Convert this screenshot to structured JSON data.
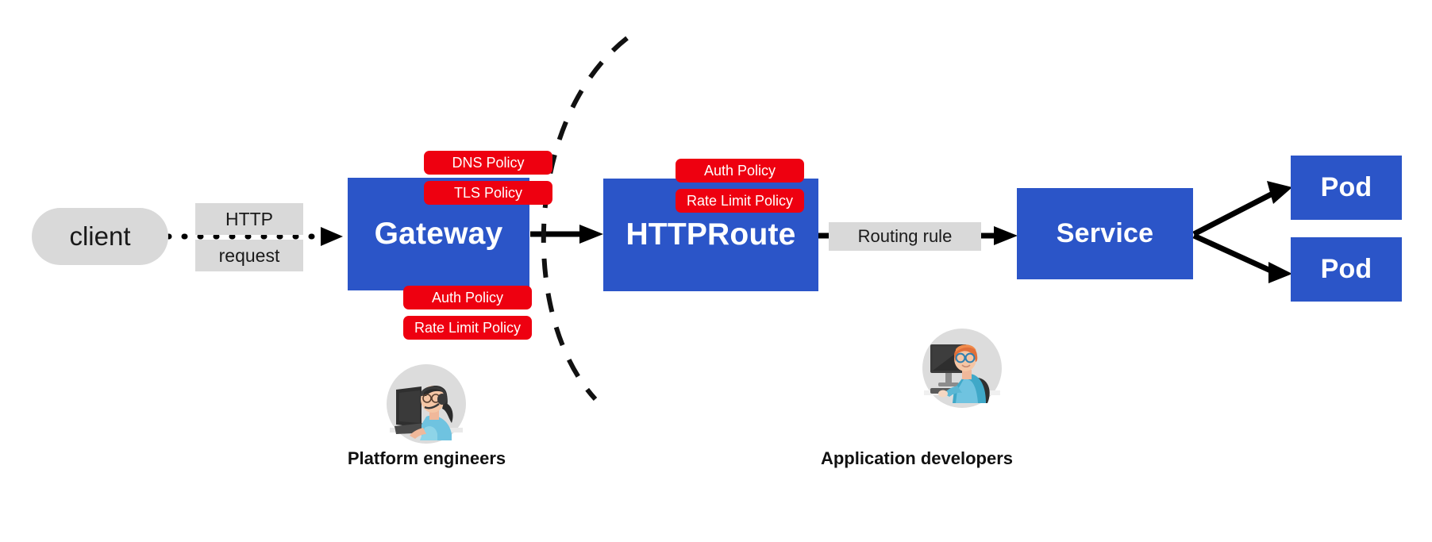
{
  "diagram": {
    "title": "Kubernetes Gateway API request flow with policy attachment",
    "colors": {
      "resource_blue": "#2B55C8",
      "policy_red": "#EE0010",
      "label_grey": "#d9d9d9",
      "line_black": "#000000"
    }
  },
  "nodes": {
    "client": {
      "label": "client",
      "shape": "rounded-pill"
    },
    "gateway": {
      "label": "Gateway",
      "shape": "rectangle"
    },
    "httproute": {
      "label": "HTTPRoute",
      "shape": "rectangle"
    },
    "service": {
      "label": "Service",
      "shape": "rectangle"
    },
    "pod_top": {
      "label": "Pod",
      "shape": "rectangle"
    },
    "pod_bottom": {
      "label": "Pod",
      "shape": "rectangle"
    }
  },
  "edge_labels": {
    "http": "HTTP",
    "request": "request",
    "routing_rule": "Routing rule"
  },
  "policies": {
    "gateway_top": [
      {
        "label": "DNS Policy"
      },
      {
        "label": "TLS Policy"
      }
    ],
    "gateway_bottom": [
      {
        "label": "Auth Policy"
      },
      {
        "label": "Rate Limit Policy"
      }
    ],
    "httproute_top": [
      {
        "label": "Auth Policy"
      },
      {
        "label": "Rate Limit Policy"
      }
    ]
  },
  "personas": [
    {
      "caption": "Platform engineers",
      "avatar": "person-with-headset-at-computer-avatar"
    },
    {
      "caption": "Application developers",
      "avatar": "person-with-glasses-at-monitor-avatar"
    }
  ],
  "separator": {
    "name": "dashed-responsibility-boundary",
    "style": "dashed-arc"
  }
}
